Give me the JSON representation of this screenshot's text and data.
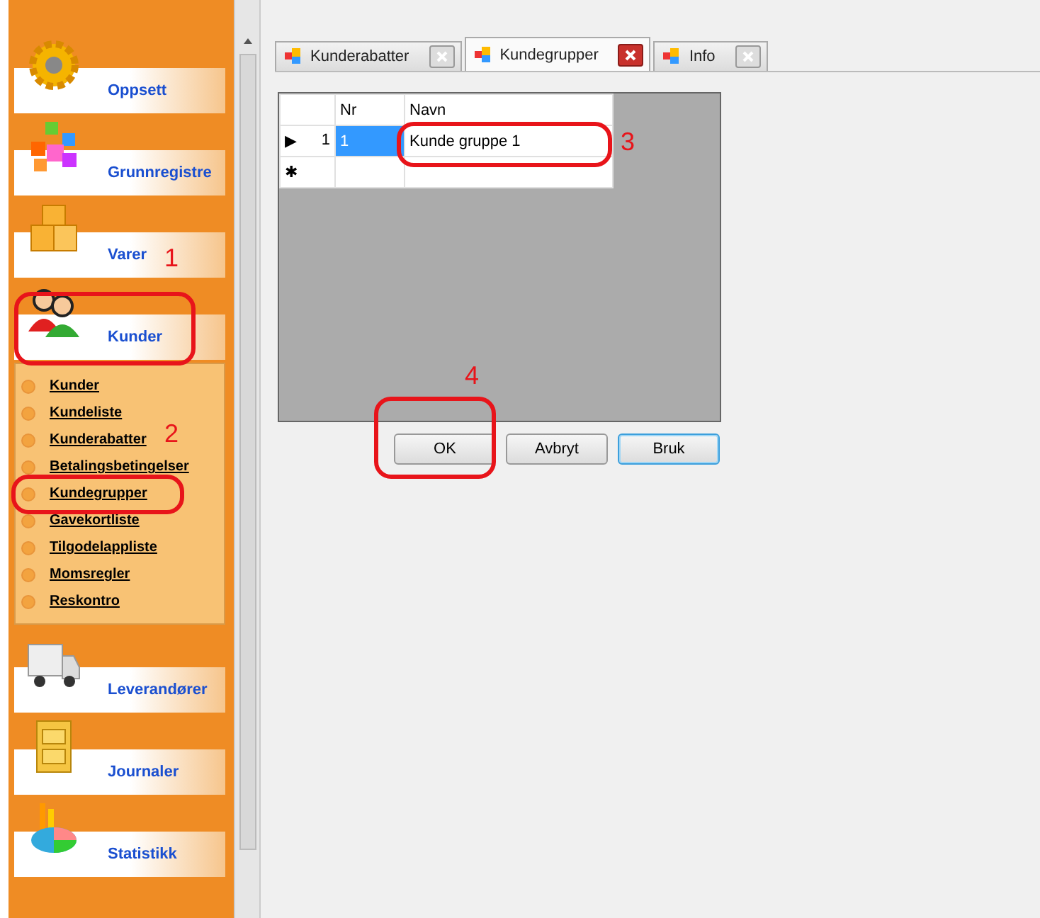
{
  "sidebar": {
    "groups": [
      {
        "label": "Oppsett"
      },
      {
        "label": "Grunnregistre"
      },
      {
        "label": "Varer"
      },
      {
        "label": "Kunder",
        "items": [
          "Kunder",
          "Kundeliste",
          "Kunderabatter",
          "Betalingsbetingelser",
          "Kundegrupper",
          "Gavekortliste",
          "Tilgodelappliste",
          "Momsregler",
          "Reskontro"
        ]
      },
      {
        "label": "Leverandører"
      },
      {
        "label": "Journaler"
      },
      {
        "label": "Statistikk"
      }
    ]
  },
  "tabs": [
    {
      "label": "Kunderabatter",
      "selected": false
    },
    {
      "label": "Kundegrupper",
      "selected": true
    },
    {
      "label": "Info",
      "selected": false
    }
  ],
  "grid": {
    "columns": [
      "Nr",
      "Navn"
    ],
    "rows": [
      {
        "marker": "▶",
        "number": "1",
        "cells": [
          {
            "text": "1",
            "selected": true
          },
          {
            "text": "Kunde gruppe 1",
            "selected": false
          }
        ]
      },
      {
        "marker": "✱",
        "number": "",
        "cells": [
          {
            "text": "",
            "selected": false
          },
          {
            "text": "",
            "selected": false
          }
        ]
      }
    ]
  },
  "buttons": [
    {
      "label": "OK",
      "focused": false
    },
    {
      "label": "Avbryt",
      "focused": false
    },
    {
      "label": "Bruk",
      "focused": true
    }
  ],
  "annotations": [
    "1",
    "2",
    "3",
    "4"
  ]
}
